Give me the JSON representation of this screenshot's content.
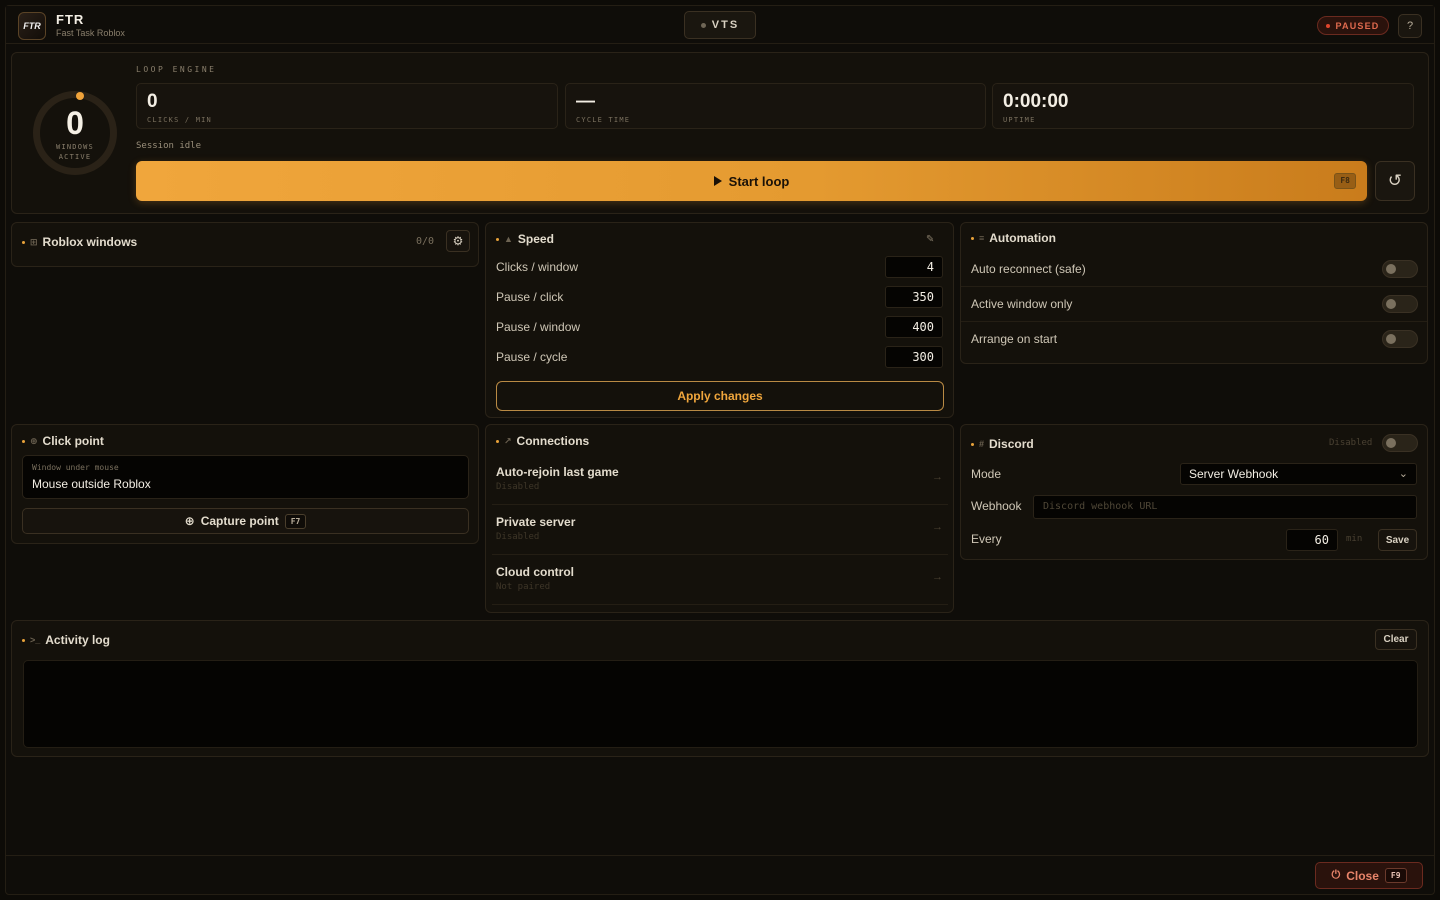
{
  "app": {
    "title": "FTR",
    "subtitle": "Fast Task Roblox",
    "logo_text": "FTR",
    "vts_label": "VTS",
    "status_badge": "PAUSED",
    "help_label": "?"
  },
  "loop_engine": {
    "title": "LOOP ENGINE",
    "windows_active_value": "0",
    "windows_active_label_1": "WINDOWS",
    "windows_active_label_2": "ACTIVE",
    "stats": [
      {
        "value": "0",
        "label": "CLICKS / MIN"
      },
      {
        "value": "—",
        "label": "CYCLE TIME"
      },
      {
        "value": "0:00:00",
        "label": "UPTIME"
      }
    ],
    "session_status": "Session idle",
    "start_label": "Start loop",
    "start_hotkey": "F8",
    "reset_icon": "↺"
  },
  "roblox_windows": {
    "title": "Roblox windows",
    "count": "0/0"
  },
  "speed": {
    "title": "Speed",
    "rows": [
      {
        "label": "Clicks / window",
        "value": "4"
      },
      {
        "label": "Pause / click",
        "value": "350"
      },
      {
        "label": "Pause / window",
        "value": "400"
      },
      {
        "label": "Pause / cycle",
        "value": "300"
      }
    ],
    "apply_label": "Apply changes"
  },
  "automation": {
    "title": "Automation",
    "toggles": [
      {
        "label": "Auto reconnect (safe)",
        "on": false
      },
      {
        "label": "Active window only",
        "on": false
      },
      {
        "label": "Arrange on start",
        "on": false
      }
    ]
  },
  "click_point": {
    "title": "Click point",
    "window_under_mouse_label": "Window under mouse",
    "window_under_mouse_value": "Mouse outside Roblox",
    "capture_label": "Capture point",
    "capture_hotkey": "F7"
  },
  "connections": {
    "title": "Connections",
    "rows": [
      {
        "label": "Auto-rejoin last game",
        "sub": "Disabled"
      },
      {
        "label": "Private server",
        "sub": "Disabled"
      },
      {
        "label": "Cloud control",
        "sub": "Not paired"
      }
    ],
    "arrow": "→"
  },
  "discord": {
    "title": "Discord",
    "state_label": "Disabled",
    "mode_label": "Mode",
    "mode_value": "Server Webhook",
    "webhook_label": "Webhook",
    "webhook_placeholder": "Discord webhook URL",
    "every_label": "Every",
    "every_value": "60",
    "every_unit": "min",
    "save_label": "Save"
  },
  "activity_log": {
    "title": "Activity log",
    "clear_label": "Clear"
  },
  "footer": {
    "close_label": "Close",
    "close_hotkey": "F9"
  },
  "colors": {
    "accent": "#f0a63c",
    "danger": "#e0452d",
    "background": "#0f0d09"
  }
}
